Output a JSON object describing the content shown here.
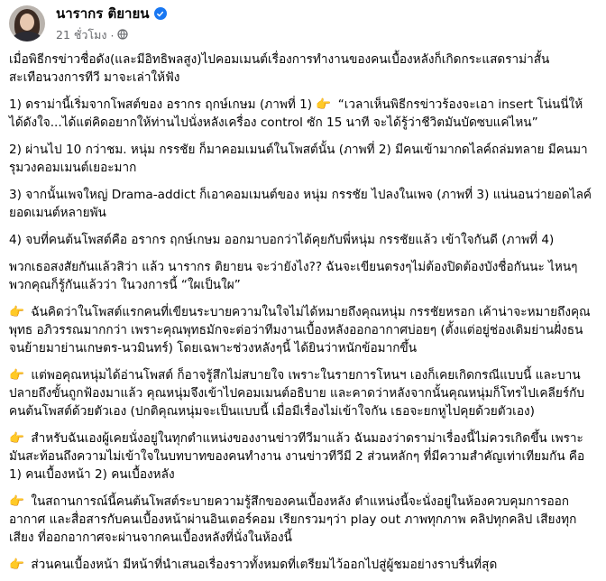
{
  "post": {
    "author": "นารากร ติยายน",
    "timestamp": "21 ชั่วโมง",
    "privacy_icon": "globe-icon",
    "verified_icon": "verified-badge-icon",
    "more_icon": "more-options-icon",
    "accent_color": "#1877f2"
  },
  "content": {
    "p1": "เมื่อพิธีกรข่าวชื่อดัง(และมีอิทธิพลสูง)ไปคอมเมนต์เรื่องการทำงานของคนเบื้องหลังก็เกิดกระแสดราม่าสั้น สะเทือนวงการทีวี มาจะเล่าให้ฟัง",
    "p2a": "1) ดราม่านี้เริ่มจากโพสต์ของ อรากร ฤกษ์เกษม (ภาพที่ 1)",
    "p2b": "“เวลาเห็นพิธีกรข่าวร้องจะเอา insert โน่นนี่ให้ได้ดังใจ...ได้แต่คิดอยากให้ท่านไปนั่งหลังเครื่อง control ซัก 15 นาที จะได้รู้ว่าชีวิตมันบัดซบแค่ไหน”",
    "p3": "2) ผ่านไป 10 กว่าชม. หนุ่ม กรรชัย ก็มาคอมเมนต์ในโพสต์นั้น (ภาพที่ 2) มีคนเข้ามากดไลค์ถล่มทลาย มีคนมารุมวงคอมเมนต์เยอะมาก",
    "p4": "3) จากนั้นเพจใหญ่ Drama-addict ก็เอาคอมเมนต์ของ หนุ่ม กรรชัย ไปลงในเพจ (ภาพที่ 3) แน่นอนว่ายอดไลค์ ยอดเมนต์หลายพัน",
    "p5": "4) จบที่คนต้นโพสต์คือ อรากร ฤกษ์เกษม ออกมาบอกว่าได้คุยกับพี่หนุ่ม กรรชัยแล้ว เข้าใจกันดี (ภาพที่ 4)",
    "p6": "พวกเธอสงสัยกันแล้วสิว่า แล้ว นารากร ติยายน จะว่ายังไง?? ฉันจะเขียนตรงๆไม่ต้องปิดต้องบังชื่อกันนะ ไหนๆพวกคุณก็รู้กันแล้วว่า ในวงการนี้ “ใผเป็นใผ”",
    "p7": "ฉันคิดว่าในโพสต์แรกคนที่เขียนระบายความในใจไม่ได้หมายถึงคุณหนุ่ม กรรชัยหรอก เค้าน่าจะหมายถึงคุณพุทธ อภิวรรณมากกว่า เพราะคุณพุทธมักจะต่อว่าทีมงานเบื้องหลังออกอากาศบ่อยๆ (ตั้งแต่อยู่ช่องเดิมย่านฝั่งธนจนย้ายมาย่านเกษตร-นวมินทร์) โดยเฉพาะช่วงหลังๆนี้ ได้ยินว่าหนักข้อมากขึ้น",
    "p8": "แต่พอคุณหนุ่มได้อ่านโพสต์ ก็อาจรู้สึกไม่สบายใจ เพราะในรายการโหนฯ เองก็เคยเกิดกรณีแบบนี้ และบานปลายถึงขั้นถูกฟ้องมาแล้ว คุณหนุ่มจึงเข้าไปคอมเมนต์อธิบาย และคาดว่าหลังจากนั้นคุณหนุ่มก็โทรไปเคลียร์กับคนต้นโพสต์ด้วยตัวเอง (ปกติคุณหนุ่มจะเป็นแบบนี้ เมื่อมีเรื่องไม่เข้าใจกัน เธอจะยกหูไปคุยด้วยตัวเอง)",
    "p9": "สำหรับฉันเองผู้เคยนั่งอยู่ในทุกตำแหน่งของงานข่าวทีวีมาแล้ว ฉันมองว่าดราม่าเรื่องนี้ไม่ควรเกิดขึ้น เพราะมันสะท้อนถึงความไม่เข้าใจในบทบาทของคนทำงาน งานข่าวทีวีมี 2 ส่วนหลักๆ ที่มีความสำคัญเท่าเทียมกัน คือ 1) คนเบื้องหน้า 2) คนเบื้องหลัง",
    "p10": "ในสถานการณ์นี้คนต้นโพสต์ระบายความรู้สึกของคนเบื้องหลัง ตำแหน่งนี้จะนั่งอยู่ในห้องควบคุมการออกอากาศ และสื่อสารกับคนเบื้องหน้าผ่านอินเตอร์คอม เรียกรวมๆว่า play out ภาพทุกภาพ คลิปทุกคลิป เสียงทุกเสียง ที่ออกอากาศจะผ่านจากคนเบื้องหลังที่นั่งในห้องนี้",
    "p11": "ส่วนคนเบื้องหน้า มีหน้าที่นำเสนอเรื่องราวทั้งหมดที่เตรียมไว้ออกไปสู่ผู้ชมอย่างราบรื่นที่สุด"
  }
}
